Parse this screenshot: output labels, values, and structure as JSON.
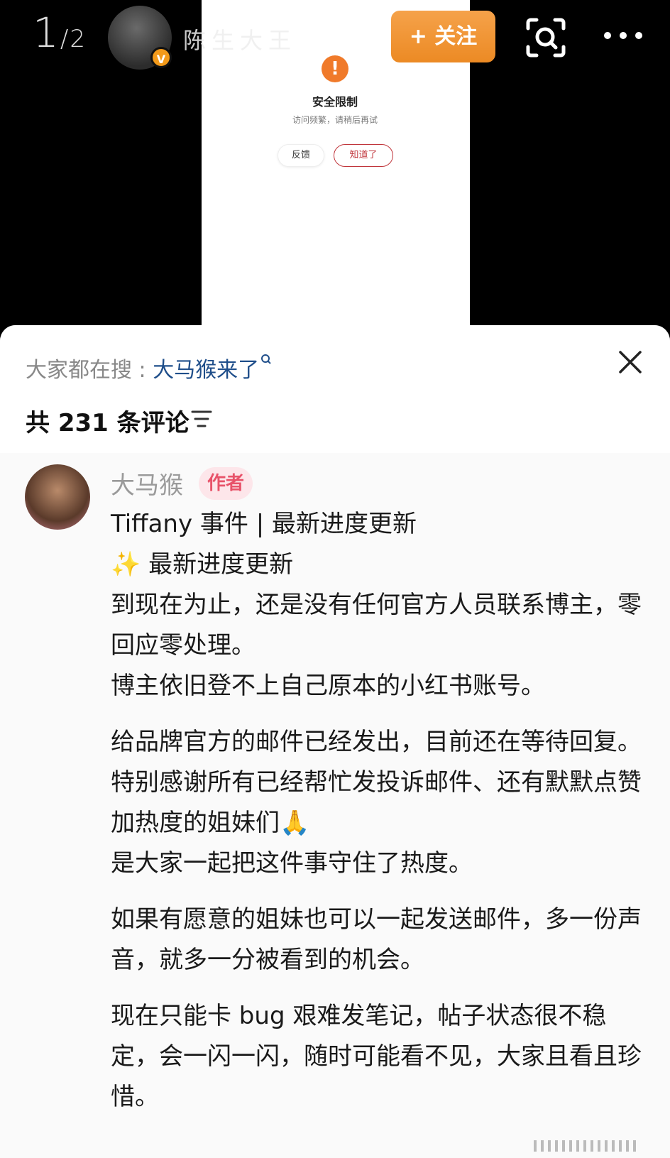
{
  "top_bar": {
    "page_current": "1",
    "page_total": "2",
    "user_name": "陈生大王",
    "verified_badge": "V",
    "follow_label": "+ 关注"
  },
  "embedded_dialog": {
    "title": "安全限制",
    "subtitle": "访问频繁，请稍后再试",
    "feedback_label": "反馈",
    "ok_label": "知道了"
  },
  "comments_sheet": {
    "search_prefix": "大家都在搜 : ",
    "search_keyword": "大马猴来了",
    "count_label": "共 231 条评论"
  },
  "comment": {
    "author": "大马猴",
    "author_tag": "作者",
    "lines": [
      "Tiffany 事件 | 最新进度更新",
      "✨ 最新进度更新",
      "到现在为止，还是没有任何官方人员联系博主，零回应零处理。",
      "博主依旧登不上自己原本的小红书账号。",
      "",
      "给品牌官方的邮件已经发出，目前还在等待回复。",
      "特别感谢所有已经帮忙发投诉邮件、还有默默点赞加热度的姐妹们🙏",
      "是大家一起把这件事守住了热度。",
      "",
      "如果有愿意的姐妹也可以一起发送邮件，多一份声音，就多一分被看到的机会。",
      "",
      "现在只能卡 bug 艰难发笔记，帖子状态很不稳定，会一闪一闪，随时可能看不见，大家且看且珍惜。"
    ]
  }
}
